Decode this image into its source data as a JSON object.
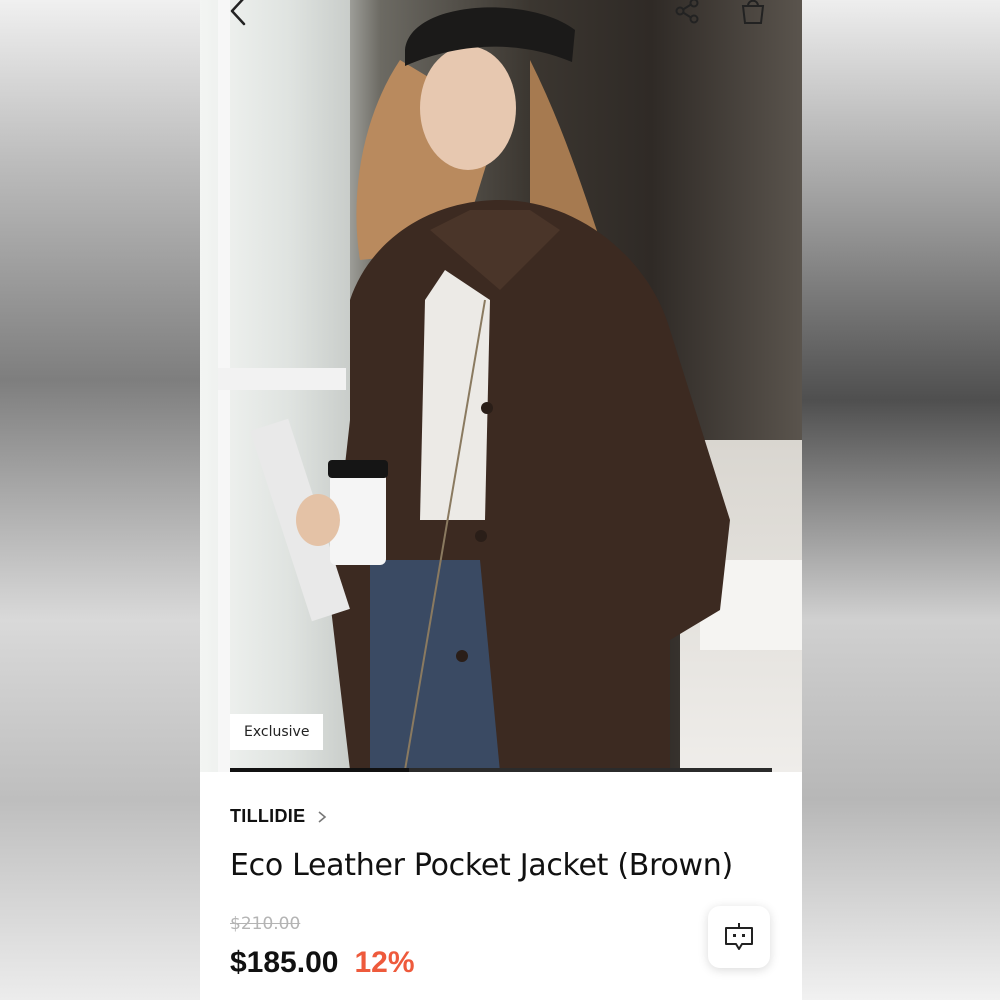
{
  "header": {
    "back_icon": "chevron-left-icon",
    "share_icon": "share-icon",
    "bag_icon": "shopping-bag-icon"
  },
  "gallery": {
    "badge": "Exclusive",
    "progress": 0.33
  },
  "product": {
    "brand": "TILLIDIE",
    "name": "Eco Leather Pocket Jacket (Brown)",
    "original_price": "$210.00",
    "price": "$185.00",
    "discount": "12%"
  },
  "colors": {
    "discount": "#ee5a3c",
    "text": "#111111",
    "muted": "#b4b4b4"
  },
  "chat_fab": {
    "icon": "chat-bot-icon"
  }
}
